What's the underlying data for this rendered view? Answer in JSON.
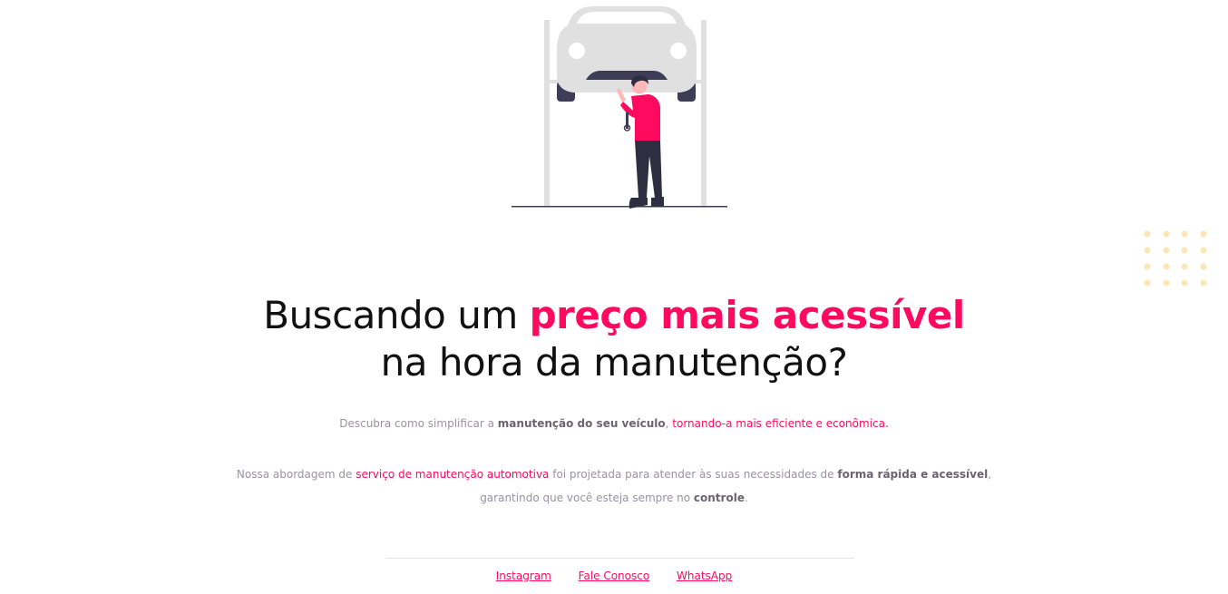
{
  "headline": {
    "part1": "Buscando um ",
    "highlight": "preço mais acessível",
    "line2": "na hora da manutenção?"
  },
  "paragraph1": {
    "t1": "Descubra como simplificar a ",
    "bold1": "manutenção do seu veículo",
    "t2": ", ",
    "pink1": "tornando-a mais eficiente e econômica."
  },
  "paragraph2": {
    "t1": "Nossa abordagem de ",
    "pink1": "serviço de manutenção automotiva",
    "t2": " foi projetada para atender às suas necessidades de ",
    "bold1": "forma rápida e acessível",
    "t3": ",",
    "t4": "garantindo que você esteja sempre no ",
    "bold2": "controle",
    "t5": "."
  },
  "footer": {
    "links": [
      "Instagram",
      "Fale Conosco",
      "WhatsApp"
    ]
  },
  "colors": {
    "accent": "#ff0a5e",
    "text_muted": "#9a92a0",
    "text_bold": "#6b6370",
    "dots": "#fde6b6",
    "car_body": "#e0e0e0"
  },
  "icons": {
    "illustration": "mechanic-under-car-illustration",
    "decoration": "dot-grid-decoration"
  }
}
